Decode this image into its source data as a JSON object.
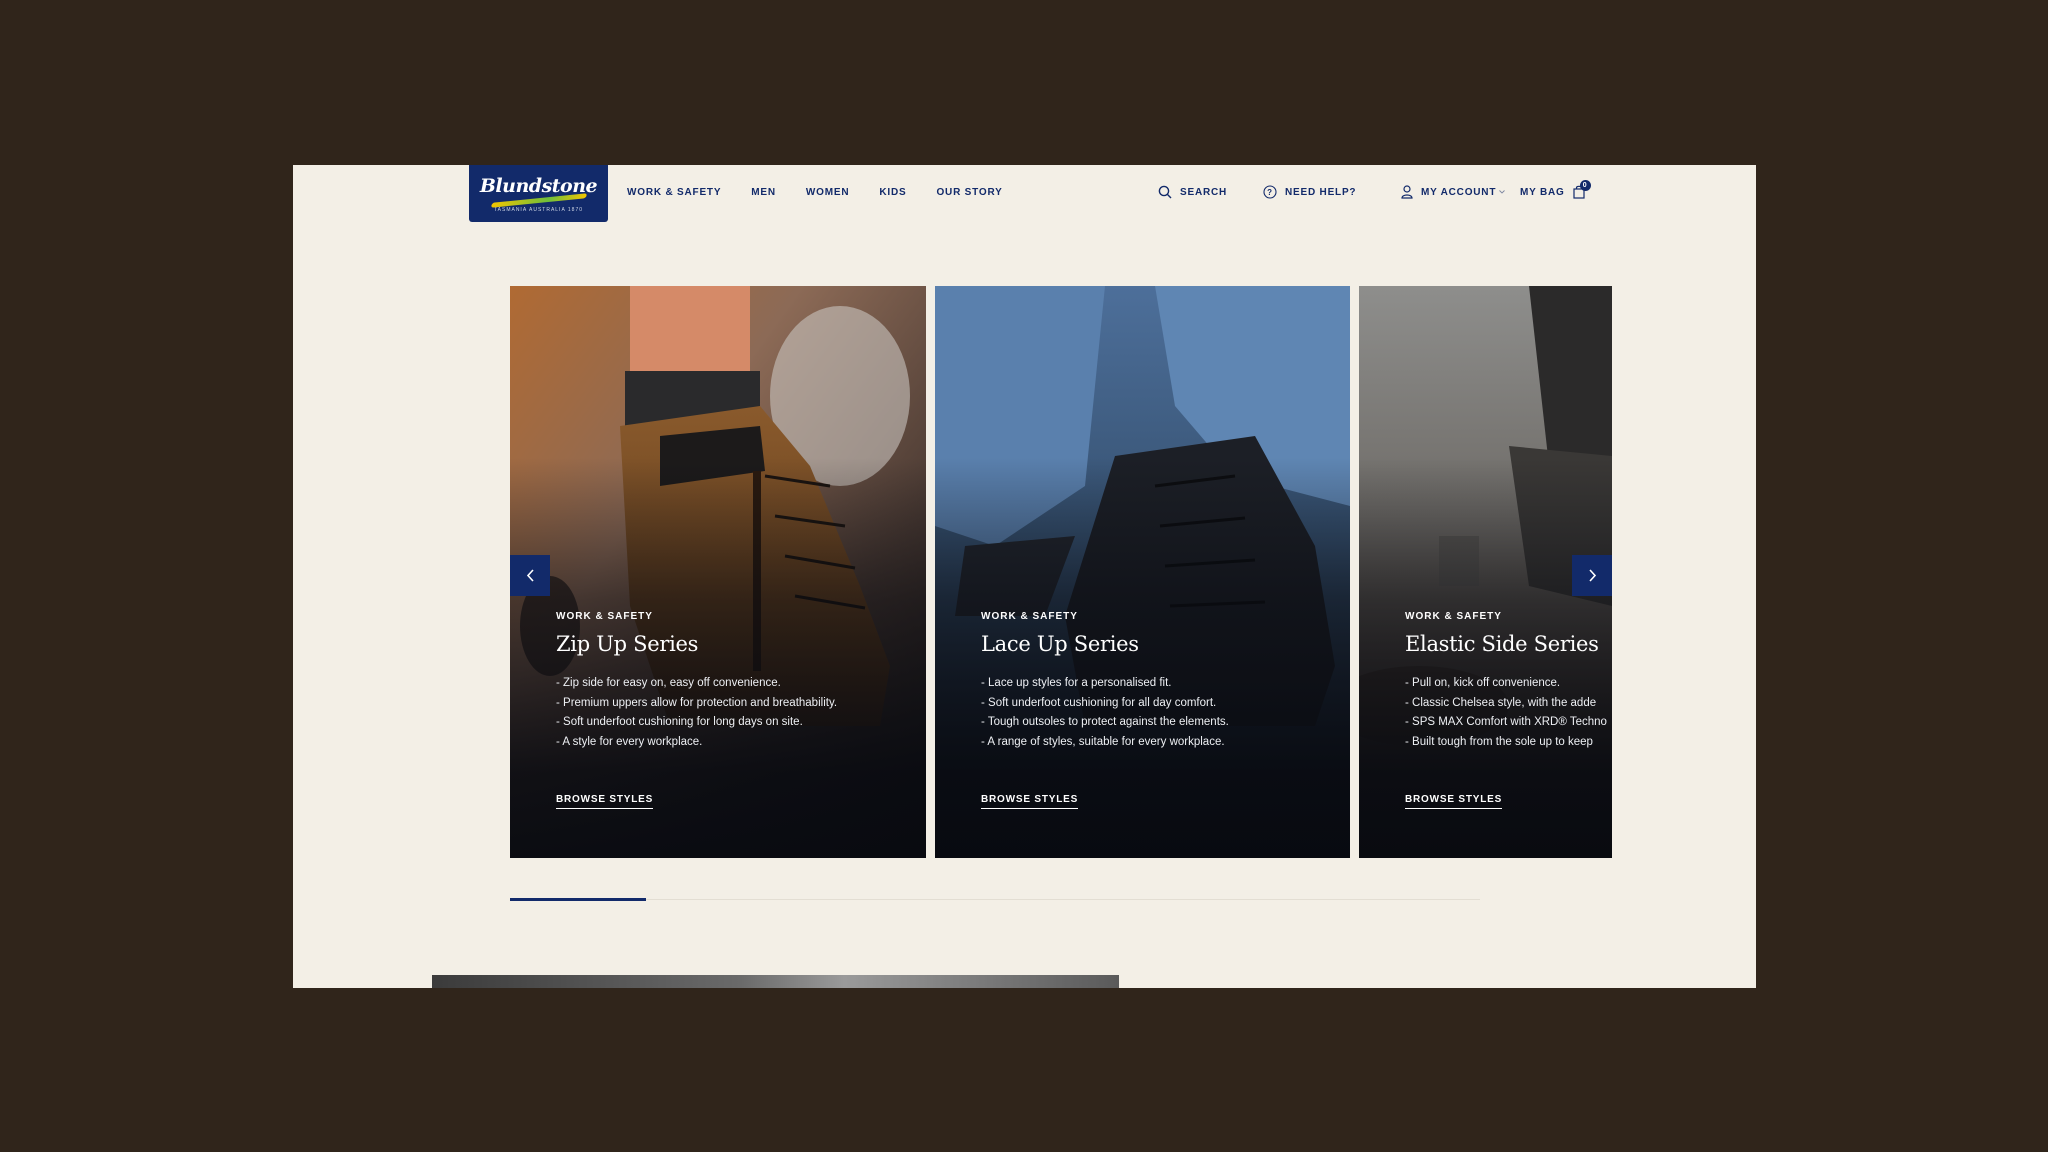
{
  "brand": {
    "name": "Blundstone",
    "tagline": "Tasmania Australia 1870"
  },
  "nav": {
    "items": [
      {
        "label": "WORK & SAFETY"
      },
      {
        "label": "MEN"
      },
      {
        "label": "WOMEN"
      },
      {
        "label": "KIDS"
      },
      {
        "label": "OUR STORY"
      }
    ]
  },
  "utils": {
    "search": "SEARCH",
    "help": "NEED HELP?",
    "account": "MY ACCOUNT",
    "bag": "MY BAG",
    "bag_count": "0"
  },
  "carousel": {
    "progress": 0.14,
    "cards": [
      {
        "kicker": "WORK & SAFETY",
        "title": "Zip Up Series",
        "bullets": [
          "- Zip side for easy on, easy off convenience.",
          "- Premium uppers allow for protection and breathability.",
          "- Soft underfoot cushioning for long days on site.",
          "- A style for every workplace."
        ],
        "cta": "BROWSE STYLES"
      },
      {
        "kicker": "WORK & SAFETY",
        "title": "Lace Up Series",
        "bullets": [
          "- Lace up styles for a personalised fit.",
          "- Soft underfoot cushioning for all day comfort.",
          "- Tough outsoles to protect against the elements.",
          "- A range of styles, suitable for every workplace."
        ],
        "cta": "BROWSE STYLES"
      },
      {
        "kicker": "WORK & SAFETY",
        "title": "Elastic Side Series",
        "bullets": [
          "- Pull on, kick off convenience.",
          "- Classic Chelsea style, with the adde",
          "- SPS MAX Comfort with XRD® Techno",
          "- Built tough from the sole up to keep"
        ],
        "cta": "BROWSE STYLES"
      }
    ]
  },
  "colors": {
    "navy": "#122a6a",
    "cream": "#f3efe6",
    "backdrop": "#30251b"
  }
}
